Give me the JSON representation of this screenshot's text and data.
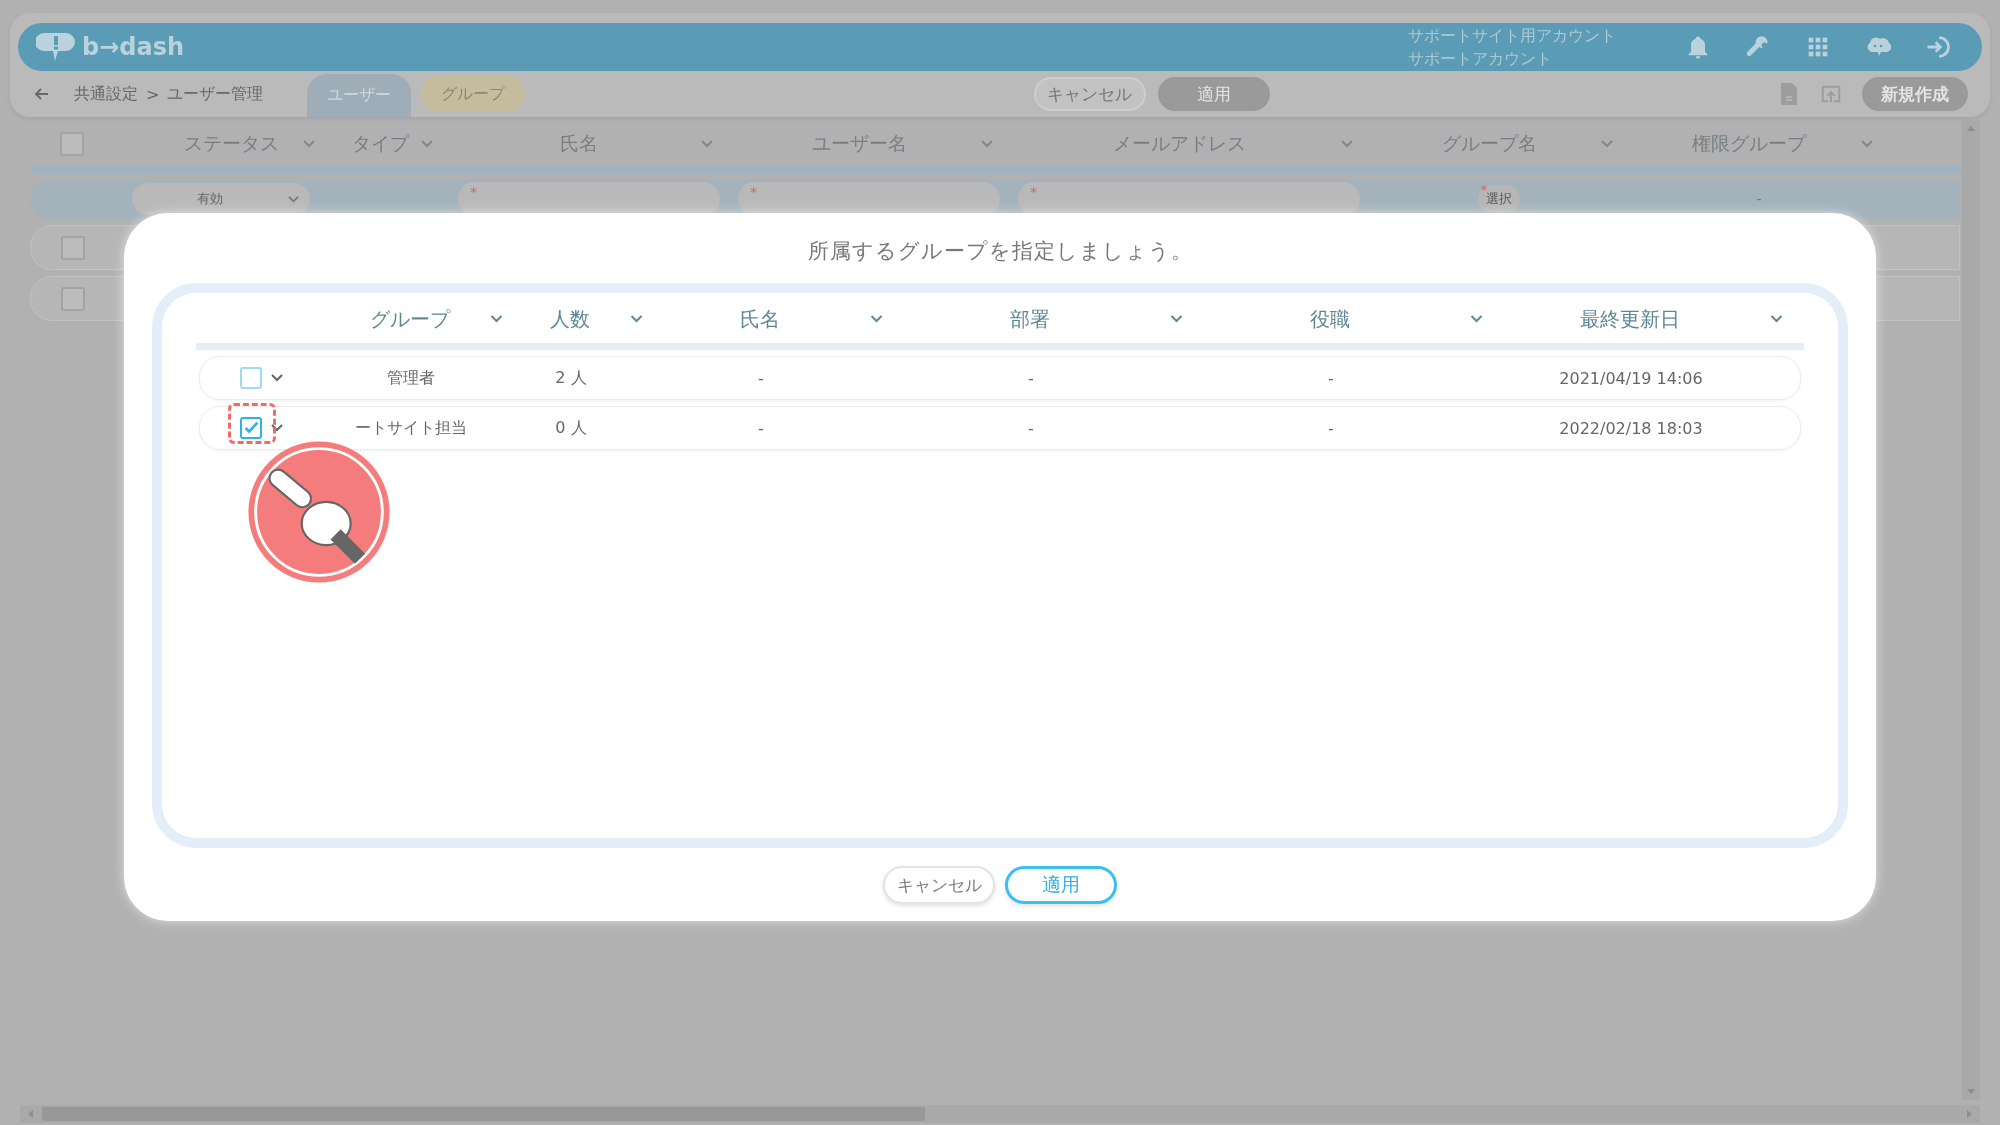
{
  "header": {
    "logo": "b→dash",
    "account": [
      "サポートサイト用アカウント",
      "サポートアカウント"
    ]
  },
  "toolbar": {
    "breadcrumb": [
      "共通設定",
      "ユーザー管理"
    ],
    "separator": ">",
    "tabs": [
      {
        "label": "ユーザー",
        "selected": true
      },
      {
        "label": "グループ",
        "selected": false
      }
    ],
    "actions": [
      {
        "label": "キャンセル",
        "kind": "outline"
      },
      {
        "label": "適用",
        "kind": "filled"
      }
    ],
    "create_button": "新規作成"
  },
  "table": {
    "columns": [
      "ステータス",
      "タイプ",
      "氏名",
      "ユーザー名",
      "メールアドレス",
      "グループ名",
      "権限グループ"
    ],
    "filter_cells": [
      {
        "kind": "select",
        "label": "有効"
      },
      {
        "kind": "empty"
      },
      {
        "kind": "input",
        "mark": "*"
      },
      {
        "kind": "input",
        "mark": "*"
      },
      {
        "kind": "input",
        "mark": "*"
      },
      {
        "kind": "button",
        "mark": "*",
        "label": "選択"
      },
      {
        "kind": "text",
        "label": "-"
      }
    ],
    "select_all_checked": false,
    "rows": [
      {
        "checked": false
      },
      {
        "checked": false
      }
    ]
  },
  "dialog": {
    "title": "所属するグループを指定しましょう。",
    "columns": [
      "グループ",
      "人数",
      "氏名",
      "部署",
      "役職",
      "最終更新日"
    ],
    "rows": [
      {
        "checked": false,
        "cells": [
          "管理者",
          "2 人",
          "-",
          "-",
          "-",
          "2021/04/19 14:06"
        ]
      },
      {
        "checked": true,
        "cells": [
          "ートサイト担当",
          "0 人",
          "-",
          "-",
          "-",
          "2022/02/18 18:03"
        ]
      }
    ],
    "buttons": [
      {
        "label": "キャンセル",
        "kind": "secondary"
      },
      {
        "label": "適用",
        "kind": "primary"
      }
    ]
  }
}
